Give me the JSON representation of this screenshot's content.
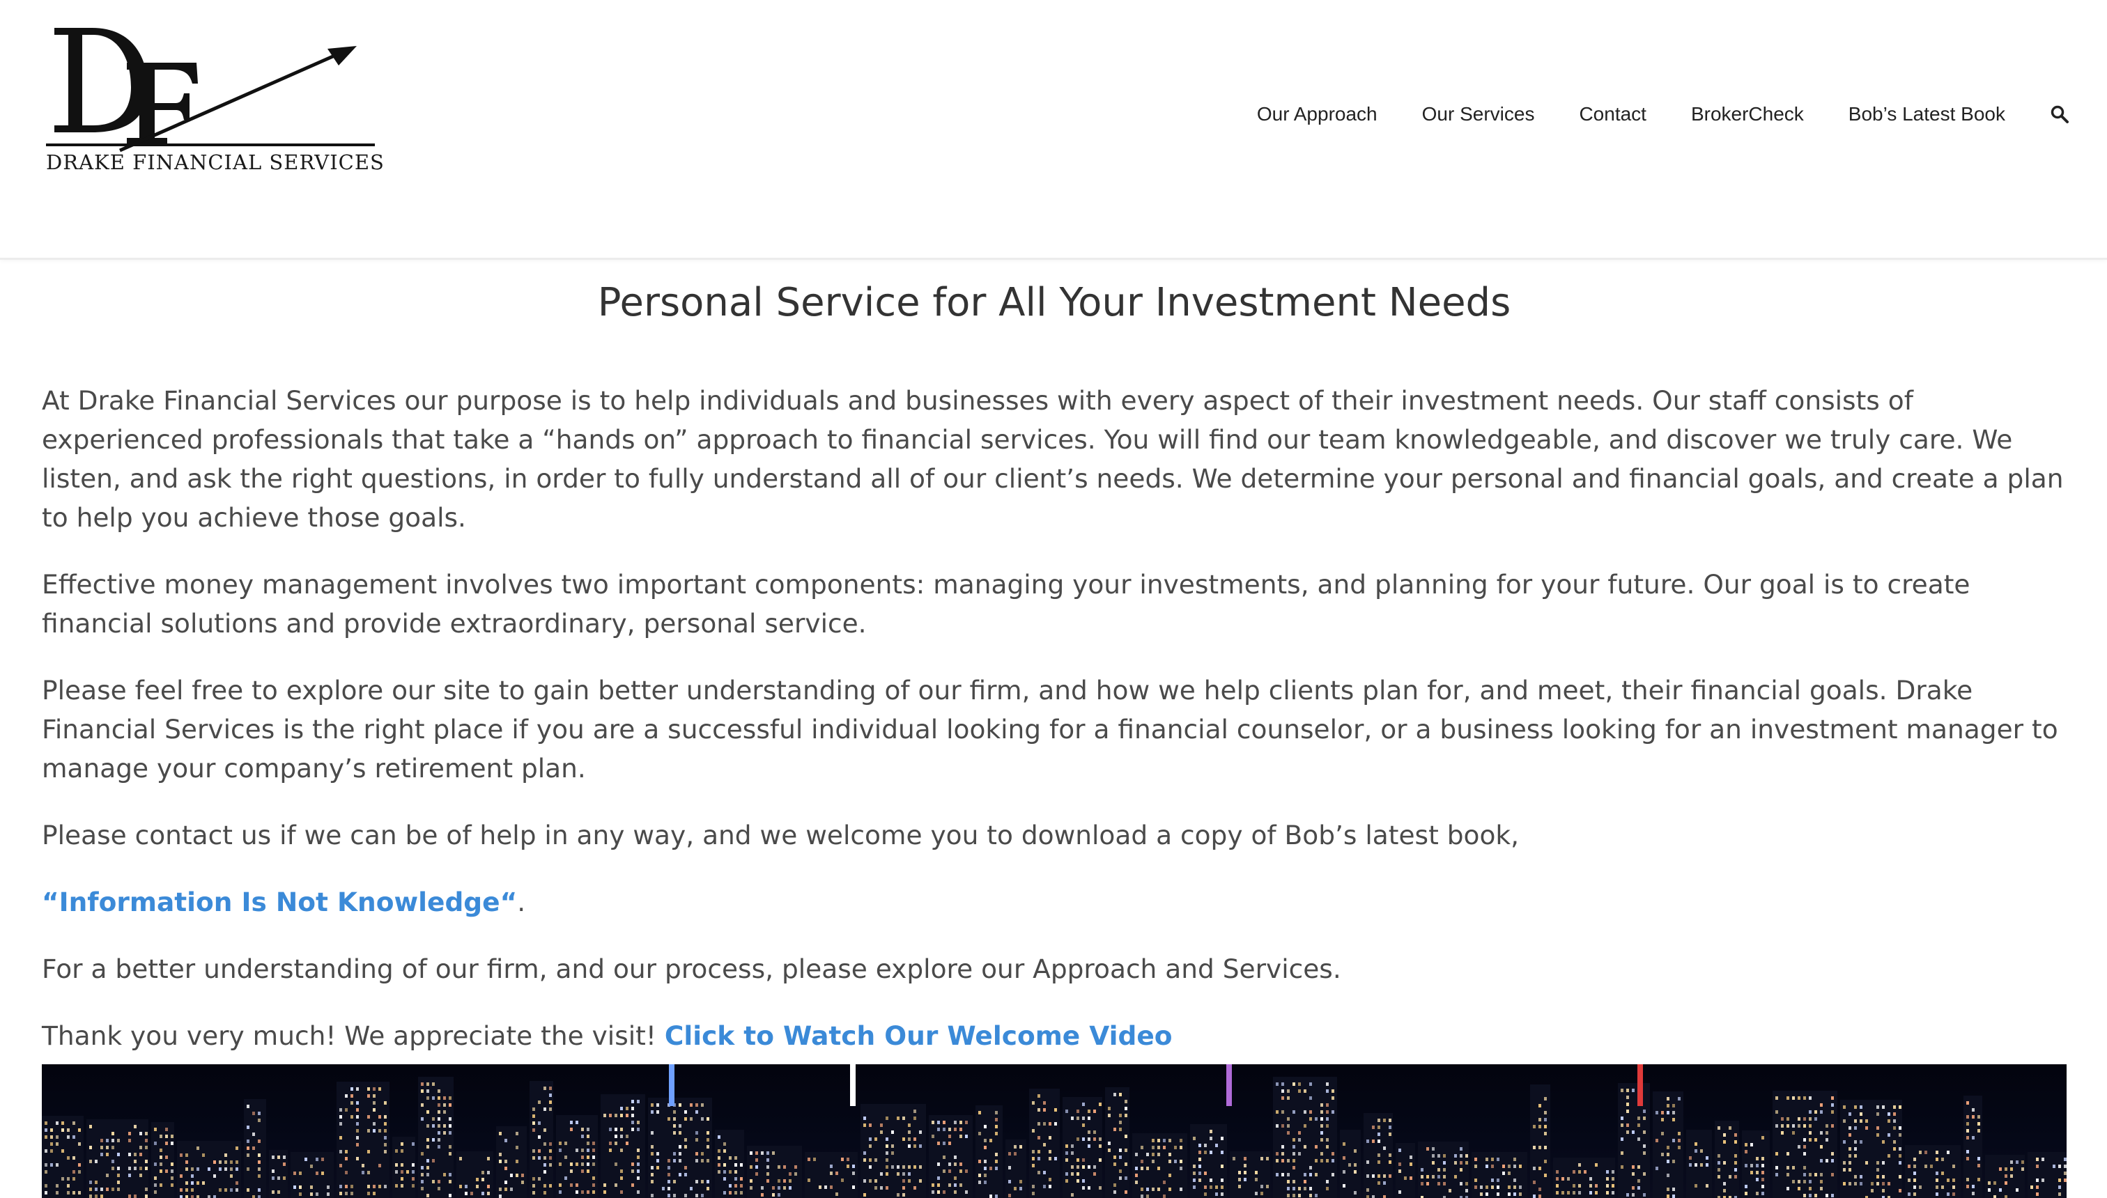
{
  "logo": {
    "monogram": "DF",
    "company_name": "Drake Financial Services"
  },
  "nav": {
    "items": [
      {
        "label": "Our Approach"
      },
      {
        "label": "Our Services"
      },
      {
        "label": "Contact"
      },
      {
        "label": "BrokerCheck"
      },
      {
        "label": "Bob’s Latest Book"
      }
    ],
    "search_icon": "search-icon"
  },
  "main": {
    "title": "Personal Service for All Your Investment Needs",
    "para1": "At Drake Financial Services our purpose is to help individuals and businesses with every aspect of their investment needs. Our staff consists of experienced professionals that take a “hands on” approach to financial services. You will find our team knowledgeable, and discover we truly care. We listen, and ask the right questions, in order to fully understand all of our client’s needs. We determine your personal and financial goals, and create a plan to help you achieve those goals.",
    "para2": "Effective money management involves two important components: managing your investments, and planning for your future. Our goal is to create financial solutions and provide extraordinary, personal service.",
    "para3": "Please feel free to explore our site to gain better understanding of our firm, and how we help clients plan for, and meet, their financial goals. Drake Financial Services is the right place if you are a successful individual looking for a financial counselor, or a business looking for an investment manager to manage your company’s retirement plan.",
    "para4": "Please contact us if we can be of help in any way, and we welcome you to download a copy of Bob’s latest book,",
    "book_link": "“Information Is Not Knowledge“",
    "book_link_suffix": ".",
    "para6": "For a better understanding of our firm, and our process, please explore our Approach and Services.",
    "para7": "Thank you very much! We appreciate the visit!",
    "video_link": "Click to Watch Our Welcome Video"
  },
  "colors": {
    "link": "#3b8ad8",
    "text": "#4a4a4a",
    "nav_text": "#222222"
  }
}
